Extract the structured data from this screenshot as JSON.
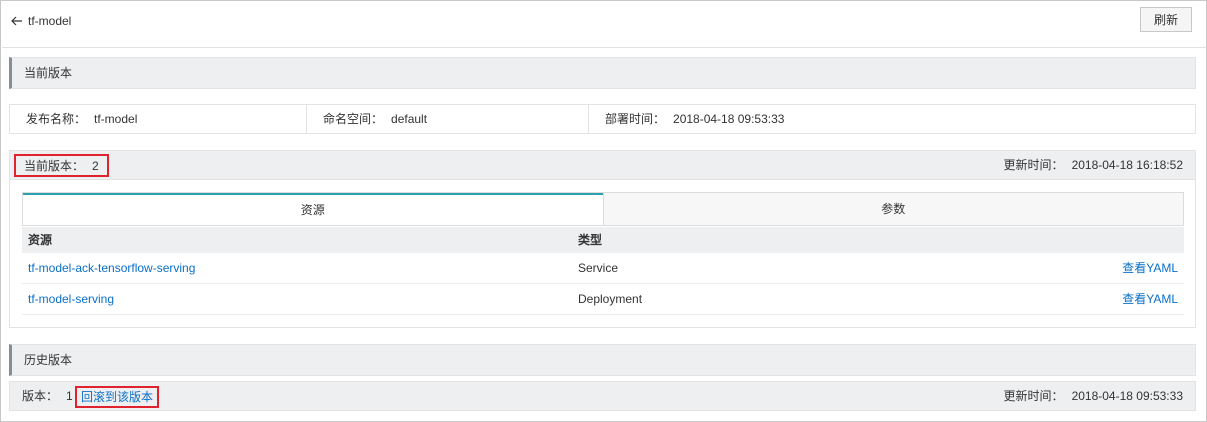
{
  "header": {
    "title": "tf-model",
    "refresh_label": "刷新"
  },
  "current_section": {
    "title": "当前版本"
  },
  "release_info": {
    "name_label": "发布名称：",
    "name_value": "tf-model",
    "namespace_label": "命名空间：",
    "namespace_value": "default",
    "deploy_time_label": "部署时间：",
    "deploy_time_value": "2018-04-18 09:53:33"
  },
  "current_version": {
    "label": "当前版本：",
    "value": "2",
    "updated_label": "更新时间：",
    "updated_value": "2018-04-18 16:18:52"
  },
  "tabs": [
    {
      "label": "资源",
      "active": true
    },
    {
      "label": "参数",
      "active": false
    }
  ],
  "resource_table": {
    "headers": [
      "资源",
      "类型"
    ],
    "rows": [
      {
        "name": "tf-model-ack-tensorflow-serving",
        "type": "Service",
        "action": "查看YAML"
      },
      {
        "name": "tf-model-serving",
        "type": "Deployment",
        "action": "查看YAML"
      }
    ]
  },
  "history_section": {
    "title": "历史版本",
    "version_label": "版本：",
    "version_value": "1",
    "rollback_label": "回滚到该版本",
    "updated_label": "更新时间：",
    "updated_value": "2018-04-18 09:53:33"
  },
  "colors": {
    "link": "#0b6fc7",
    "highlight_border": "#e0222f",
    "active_tab_accent": "#2aa0b0",
    "section_bg": "#eeeff1"
  }
}
